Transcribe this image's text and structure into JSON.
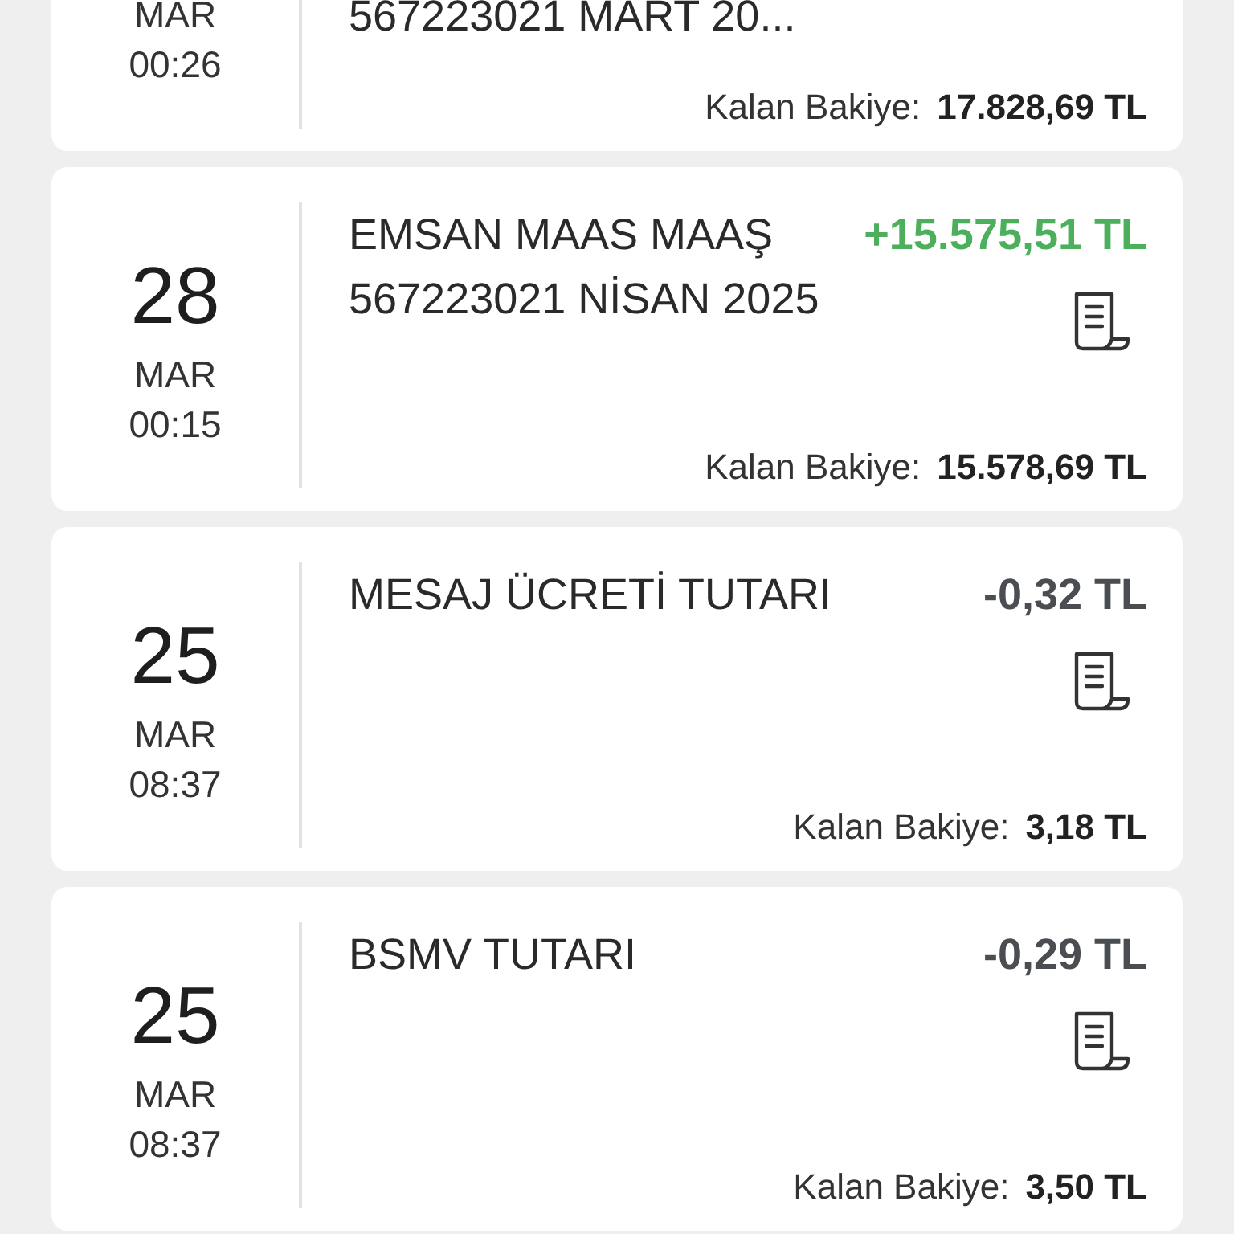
{
  "transactions": [
    {
      "month": "MAR",
      "time": "00:26",
      "description": "567223021 MART 20...",
      "balance_label": "Kalan Bakiye:",
      "balance": "17.828,69 TL"
    },
    {
      "day": "28",
      "month": "MAR",
      "time": "00:15",
      "description": "EMSAN MAAS MAAŞ 567223021 NİSAN 2025",
      "amount": "+15.575,51 TL",
      "color": "#4caf5b",
      "balance_label": "Kalan Bakiye:",
      "balance": "15.578,69 TL"
    },
    {
      "day": "25",
      "month": "MAR",
      "time": "08:37",
      "description": "MESAJ ÜCRETİ TUTARI",
      "amount": "-0,32 TL",
      "color": "#4a4d52",
      "balance_label": "Kalan Bakiye:",
      "balance": "3,18 TL"
    },
    {
      "day": "25",
      "month": "MAR",
      "time": "08:37",
      "description": "BSMV TUTARI",
      "amount": "-0,29 TL",
      "color": "#4a4d52",
      "balance_label": "Kalan Bakiye:",
      "balance": "3,50 TL"
    }
  ]
}
